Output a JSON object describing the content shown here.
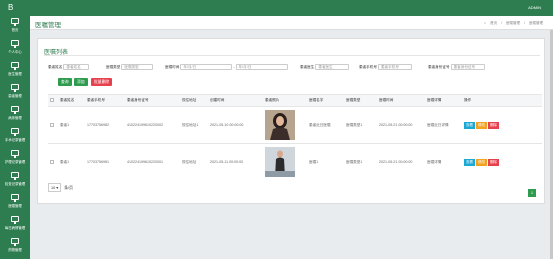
{
  "app": {
    "brand": "B",
    "user": "ADMIN"
  },
  "header": {
    "title": "医嘱管理",
    "crumbs": [
      "首页",
      "医嘱管理",
      "医嘱管理"
    ]
  },
  "sidebar": {
    "items": [
      {
        "label": "首页"
      },
      {
        "label": "个人中心"
      },
      {
        "label": "医生管理"
      },
      {
        "label": "患者管理"
      },
      {
        "label": "病床管理"
      },
      {
        "label": "手术记录管理"
      },
      {
        "label": "护理记录管理"
      },
      {
        "label": "检查记录管理"
      },
      {
        "label": "医嘱管理"
      },
      {
        "label": "每日病情管理"
      },
      {
        "label": "药物管理"
      }
    ]
  },
  "card": {
    "title": "医嘱列表"
  },
  "filters": {
    "patient_name": {
      "label": "患者姓名",
      "placeholder": "患者姓名"
    },
    "order_type": {
      "label": "医嘱类型",
      "placeholder": "医嘱类型"
    },
    "order_time": {
      "label": "医嘱时间",
      "value": "年/月/日"
    },
    "doctor": {
      "label": "患者医生",
      "placeholder": "患者医生"
    },
    "phone": {
      "label": "患者手机号",
      "placeholder": "患者手机号"
    },
    "id_no": {
      "label": "患者身份证号",
      "placeholder": "患者身份证号"
    }
  },
  "actions": {
    "search": "查询",
    "add": "添加",
    "batch_delete": "批量删除"
  },
  "table": {
    "headers": [
      "患者姓名",
      "患者手机号",
      "患者身份证号",
      "现住地址",
      "创建时间",
      "患者照片",
      "医嘱名字",
      "医嘱类型",
      "医嘱时间",
      "医嘱详情",
      "操作"
    ],
    "rows": [
      {
        "name": "患者1",
        "phone": "17703756982",
        "id_no": "410224199610220002",
        "address": "现住地址1",
        "created": "2021-05-10 00:00:00",
        "order_name": "患者近日医嘱",
        "order_type": "医嘱类型1",
        "order_time": "2021-05-21 00:00:00",
        "detail": "医嘱近日详情"
      },
      {
        "name": "患者1",
        "phone": "17703756981",
        "id_no": "410224199610220001",
        "address": "现住地址",
        "created": "2021-05-11 00:00:00",
        "order_name": "医嘱1",
        "order_type": "医嘱类型1",
        "order_time": "2021-05-21 00:00:00",
        "detail": "医嘱详情"
      }
    ],
    "ops": {
      "view": "查看",
      "edit": "修改",
      "delete": "删除"
    }
  },
  "pagination": {
    "page_size": "10",
    "suffix": "条/页",
    "page": "1"
  },
  "colors": {
    "brand": "#2e7d50",
    "success": "#2e9b4e",
    "danger": "#e6414e",
    "info": "#1aa8d4",
    "warning": "#f1a420"
  }
}
